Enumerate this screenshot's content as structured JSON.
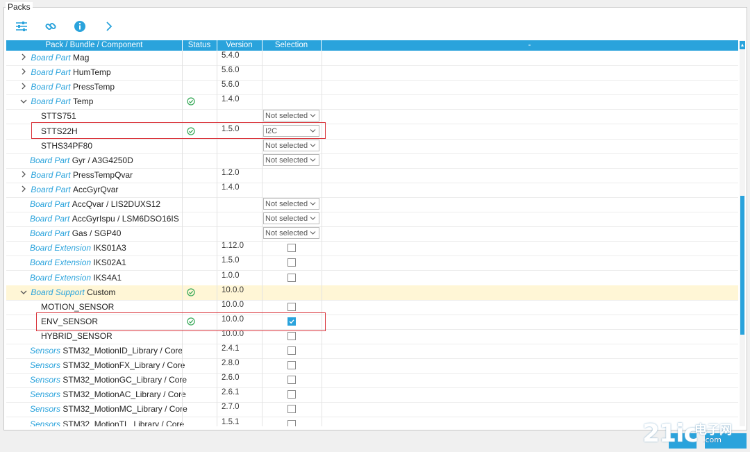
{
  "panel": {
    "title": "Packs"
  },
  "toolbar": {
    "icons": [
      "settings-sliders-icon",
      "link-icon",
      "info-icon",
      "chevron-right-icon"
    ]
  },
  "table": {
    "headers": {
      "name": "Pack / Bundle / Component",
      "status": "Status",
      "version": "Version",
      "selection": "Selection",
      "extra": "-"
    },
    "rows": [
      {
        "indent": 1,
        "expander": "collapsed",
        "type": "Board Part",
        "name": "Mag",
        "version": "5.4.0",
        "status": "",
        "selection": ""
      },
      {
        "indent": 1,
        "expander": "collapsed",
        "type": "Board Part",
        "name": "HumTemp",
        "version": "5.6.0",
        "status": "",
        "selection": ""
      },
      {
        "indent": 1,
        "expander": "collapsed",
        "type": "Board Part",
        "name": "PressTemp",
        "version": "5.6.0",
        "status": "",
        "selection": ""
      },
      {
        "indent": 1,
        "expander": "expanded",
        "type": "Board Part",
        "name": "Temp",
        "version": "1.4.0",
        "status": "ok",
        "selection": ""
      },
      {
        "indent": 2,
        "expander": "",
        "type": "",
        "name": "STTS751",
        "version": "",
        "status": "",
        "selection": "Not selected",
        "selKind": "dropdown"
      },
      {
        "indent": 2,
        "expander": "",
        "type": "",
        "name": "STTS22H",
        "version": "1.5.0",
        "status": "ok",
        "selection": "I2C",
        "selKind": "dropdown"
      },
      {
        "indent": 2,
        "expander": "",
        "type": "",
        "name": "STHS34PF80",
        "version": "",
        "status": "",
        "selection": "Not selected",
        "selKind": "dropdown"
      },
      {
        "indent": 1,
        "expander": "",
        "type": "Board Part",
        "name": "Gyr / A3G4250D",
        "version": "",
        "status": "",
        "selection": "Not selected",
        "selKind": "dropdown"
      },
      {
        "indent": 1,
        "expander": "collapsed",
        "type": "Board Part",
        "name": "PressTempQvar",
        "version": "1.2.0",
        "status": "",
        "selection": ""
      },
      {
        "indent": 1,
        "expander": "collapsed",
        "type": "Board Part",
        "name": "AccGyrQvar",
        "version": "1.4.0",
        "status": "",
        "selection": ""
      },
      {
        "indent": 1,
        "expander": "",
        "type": "Board Part",
        "name": "AccQvar / LIS2DUXS12",
        "version": "",
        "status": "",
        "selection": "Not selected",
        "selKind": "dropdown"
      },
      {
        "indent": 1,
        "expander": "",
        "type": "Board Part",
        "name": "AccGyrIspu / LSM6DSO16IS",
        "version": "",
        "status": "",
        "selection": "Not selected",
        "selKind": "dropdown"
      },
      {
        "indent": 1,
        "expander": "",
        "type": "Board Part",
        "name": "Gas / SGP40",
        "version": "",
        "status": "",
        "selection": "Not selected",
        "selKind": "dropdown"
      },
      {
        "indent": 1,
        "expander": "",
        "type": "Board Extension",
        "name": "IKS01A3",
        "version": "1.12.0",
        "status": "",
        "selection": "unchecked",
        "selKind": "checkbox"
      },
      {
        "indent": 1,
        "expander": "",
        "type": "Board Extension",
        "name": "IKS02A1",
        "version": "1.5.0",
        "status": "",
        "selection": "unchecked",
        "selKind": "checkbox"
      },
      {
        "indent": 1,
        "expander": "",
        "type": "Board Extension",
        "name": "IKS4A1",
        "version": "1.0.0",
        "status": "",
        "selection": "unchecked",
        "selKind": "checkbox"
      },
      {
        "indent": 1,
        "expander": "expanded",
        "type": "Board Support",
        "name": "Custom",
        "version": "10.0.0",
        "status": "ok",
        "selection": "",
        "highlight": true
      },
      {
        "indent": 2,
        "expander": "",
        "type": "",
        "name": "MOTION_SENSOR",
        "version": "10.0.0",
        "status": "",
        "selection": "unchecked",
        "selKind": "checkbox"
      },
      {
        "indent": 2,
        "expander": "",
        "type": "",
        "name": "ENV_SENSOR",
        "version": "10.0.0",
        "status": "ok",
        "selection": "checked",
        "selKind": "checkbox"
      },
      {
        "indent": 2,
        "expander": "",
        "type": "",
        "name": "HYBRID_SENSOR",
        "version": "10.0.0",
        "status": "",
        "selection": "unchecked",
        "selKind": "checkbox"
      },
      {
        "indent": 1,
        "expander": "",
        "type": "Sensors",
        "name": "STM32_MotionID_Library / Core",
        "version": "2.4.1",
        "status": "",
        "selection": "unchecked",
        "selKind": "checkbox"
      },
      {
        "indent": 1,
        "expander": "",
        "type": "Sensors",
        "name": "STM32_MotionFX_Library / Core",
        "version": "2.8.0",
        "status": "",
        "selection": "unchecked",
        "selKind": "checkbox"
      },
      {
        "indent": 1,
        "expander": "",
        "type": "Sensors",
        "name": "STM32_MotionGC_Library / Core",
        "version": "2.6.0",
        "status": "",
        "selection": "unchecked",
        "selKind": "checkbox"
      },
      {
        "indent": 1,
        "expander": "",
        "type": "Sensors",
        "name": "STM32_MotionAC_Library / Core",
        "version": "2.6.1",
        "status": "",
        "selection": "unchecked",
        "selKind": "checkbox"
      },
      {
        "indent": 1,
        "expander": "",
        "type": "Sensors",
        "name": "STM32_MotionMC_Library / Core",
        "version": "2.7.0",
        "status": "",
        "selection": "unchecked",
        "selKind": "checkbox"
      },
      {
        "indent": 1,
        "expander": "",
        "type": "Sensors",
        "name": "STM32_MotionTL_Library / Core",
        "version": "1.5.1",
        "status": "",
        "selection": "unchecked",
        "selKind": "checkbox"
      }
    ],
    "highlightedRows": [
      "STTS22H",
      "ENV_SENSOR"
    ]
  },
  "watermark": {
    "logo": "21ic",
    "text": "电子网",
    "domain": ".com"
  },
  "colors": {
    "accent": "#2aa3dc",
    "status_ok": "#3aaa5a",
    "highlight_row": "#fff6d6",
    "annotation_box": "#d9333a"
  }
}
